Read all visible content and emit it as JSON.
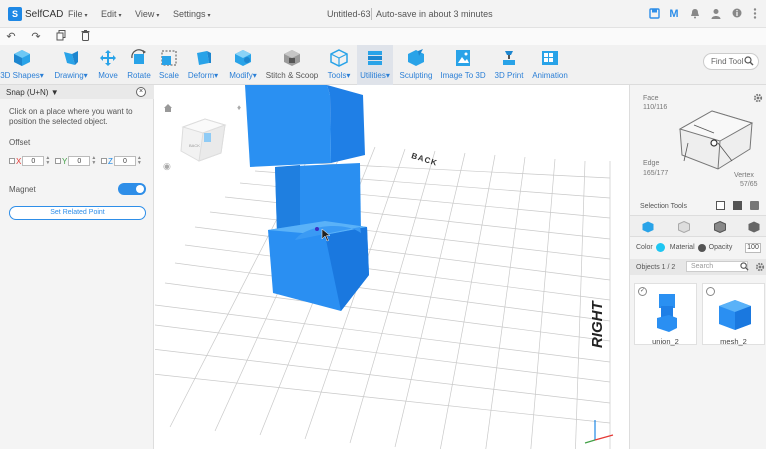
{
  "app": {
    "name": "SelfCAD",
    "logo_letter": "S"
  },
  "menu": [
    {
      "label": "File"
    },
    {
      "label": "Edit"
    },
    {
      "label": "View"
    },
    {
      "label": "Settings"
    }
  ],
  "document": {
    "title": "Untitled-63",
    "autosave": "Auto-save in about 3 minutes"
  },
  "toolbar": {
    "items": [
      {
        "label": "3D Shapes",
        "caret": true,
        "icon": "cube-icon"
      },
      {
        "label": "Drawing",
        "caret": true,
        "icon": "pencil-icon"
      },
      {
        "label": "Move",
        "caret": false,
        "icon": "move-icon"
      },
      {
        "label": "Rotate",
        "caret": false,
        "icon": "rotate-icon"
      },
      {
        "label": "Scale",
        "caret": false,
        "icon": "scale-icon"
      },
      {
        "label": "Deform",
        "caret": true,
        "icon": "deform-icon"
      },
      {
        "label": "Modify",
        "caret": true,
        "icon": "modify-icon"
      },
      {
        "label": "Stitch & Scoop",
        "caret": false,
        "icon": "stitch-icon"
      },
      {
        "label": "Tools",
        "caret": true,
        "icon": "tools-icon"
      },
      {
        "label": "Utilities",
        "caret": true,
        "icon": "utilities-icon"
      },
      {
        "label": "Sculpting",
        "caret": false,
        "icon": "sculpt-icon"
      },
      {
        "label": "Image To 3D",
        "caret": false,
        "icon": "image-icon"
      },
      {
        "label": "3D Print",
        "caret": false,
        "icon": "print-icon"
      },
      {
        "label": "Animation",
        "caret": false,
        "icon": "animation-icon"
      }
    ],
    "find_tool": "Find Tool"
  },
  "snap_panel": {
    "title": "Snap (U+N)",
    "description": "Click on a place where you want to position the selected object.",
    "offset_label": "Offset",
    "offsets": [
      {
        "axis": "X",
        "value": "0",
        "color": "#e53935"
      },
      {
        "axis": "Y",
        "value": "0",
        "color": "#43a047"
      },
      {
        "axis": "Z",
        "value": "0",
        "color": "#1e88e5"
      }
    ],
    "magnet_label": "Magnet",
    "magnet_on": true,
    "set_point_button": "Set Related Point"
  },
  "viewport": {
    "back_label": "BACK",
    "right_label": "RIGHT",
    "cube_face_label": "BACK"
  },
  "right_panel": {
    "face_label": "Face",
    "face_count": "110/116",
    "edge_label": "Edge",
    "edge_count": "165/177",
    "vertex_label": "Vertex",
    "vertex_count": "57/65",
    "selection_tools": "Selection Tools",
    "color_label": "Color",
    "color_value": "#1ec6f2",
    "material_label": "Material",
    "opacity_label": "Opacity",
    "opacity_value": "100",
    "objects_count": "Objects 1 / 2",
    "search_placeholder": "Search",
    "objects": [
      {
        "name": "union_2",
        "checked": true
      },
      {
        "name": "mesh_2",
        "checked": false
      }
    ]
  },
  "colors": {
    "accent": "#2e8ee8",
    "object": "#1e88f0"
  }
}
